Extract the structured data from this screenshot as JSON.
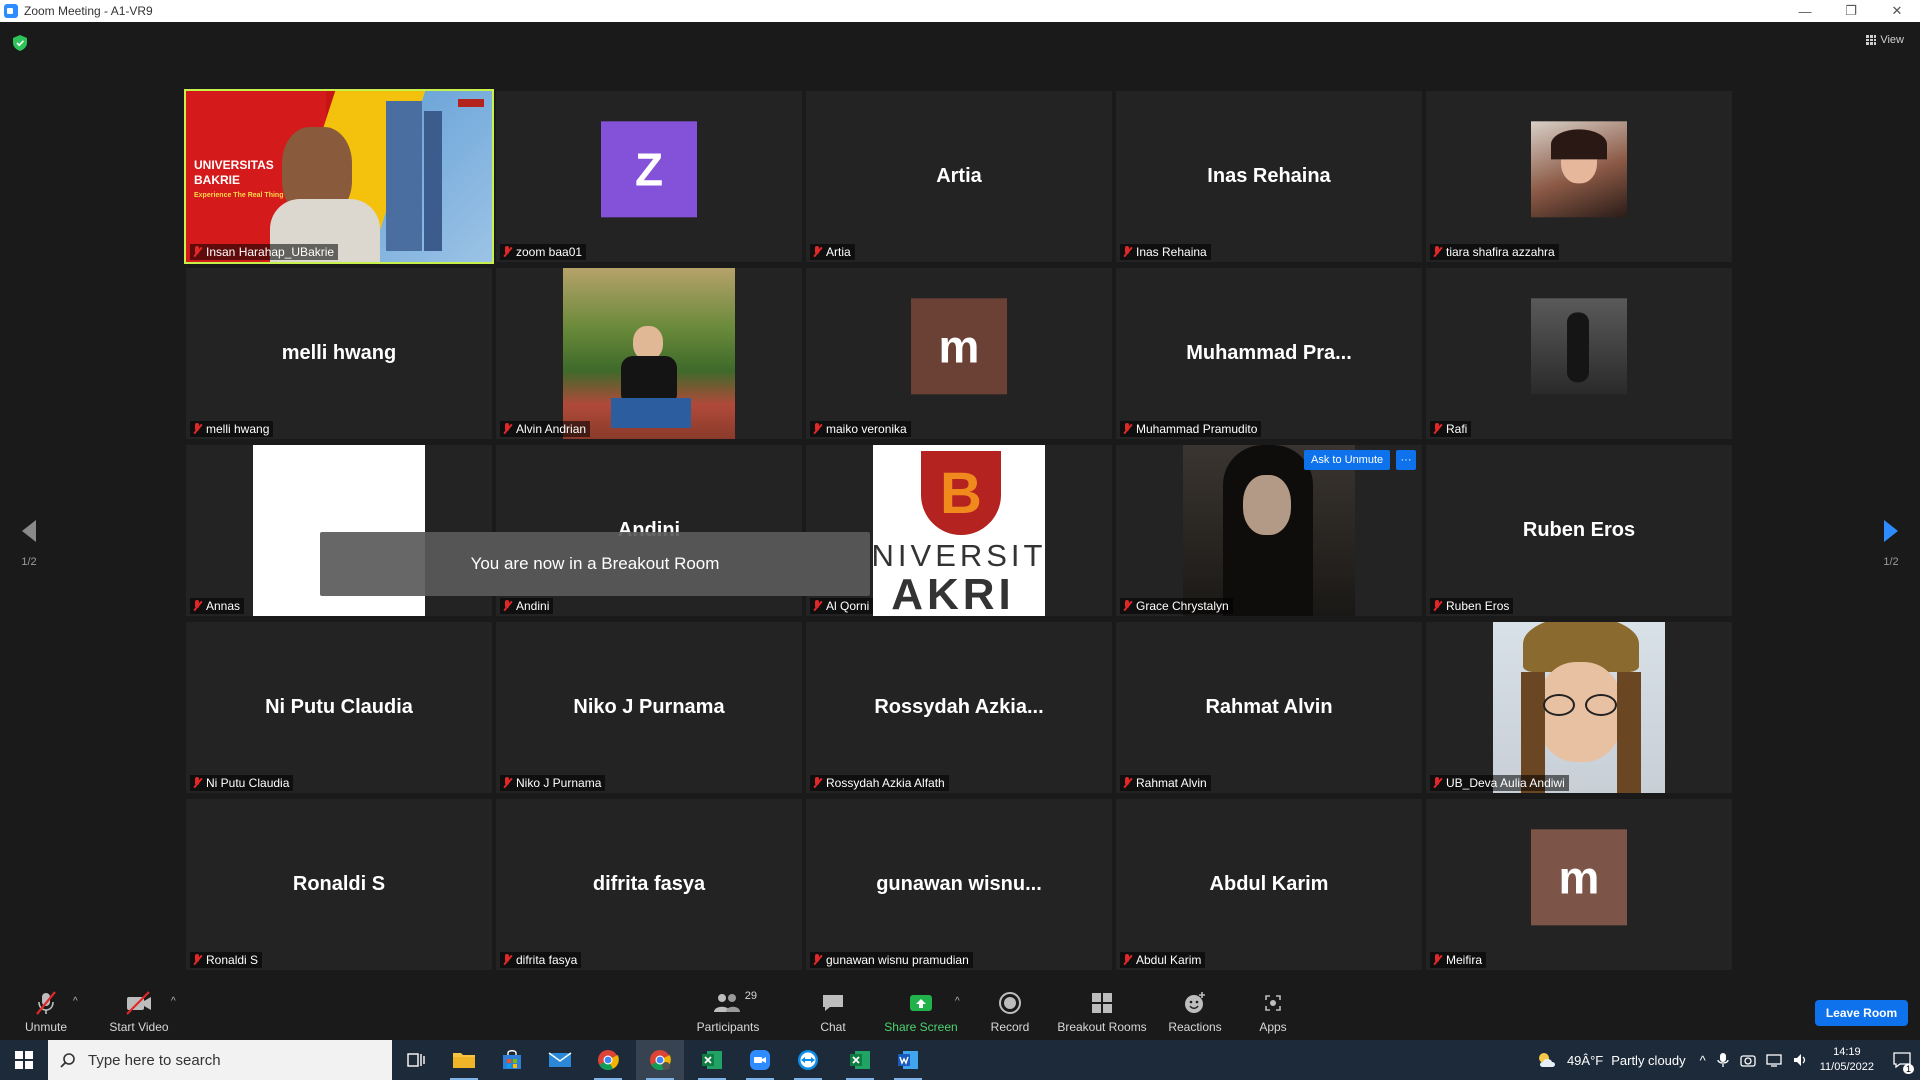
{
  "window": {
    "title": "Zoom Meeting - A1-VR9"
  },
  "header": {
    "view_label": "View"
  },
  "tiles": [
    {
      "name": "Insan Harahap_UBakrie",
      "big": "",
      "kind": "video-ub"
    },
    {
      "name": "zoom baa01",
      "big": "Z",
      "kind": "letter",
      "color": "#8452d9"
    },
    {
      "name": "Artia",
      "big": "Artia",
      "kind": "name"
    },
    {
      "name": "Inas Rehaina",
      "big": "Inas Rehaina",
      "kind": "name"
    },
    {
      "name": "tiara shafira azzahra",
      "big": "",
      "kind": "photo-sq",
      "color": "#5a3b30"
    },
    {
      "name": "melli hwang",
      "big": "melli hwang",
      "kind": "name"
    },
    {
      "name": "Alvin Andrian",
      "big": "",
      "kind": "photo-wide"
    },
    {
      "name": "maiko veronika",
      "big": "m",
      "kind": "letter",
      "color": "#6b4136"
    },
    {
      "name": "Muhammad Pramudito",
      "big": "Muhammad  Pra...",
      "kind": "name"
    },
    {
      "name": "Rafi",
      "big": "",
      "kind": "photo-sq-dark"
    },
    {
      "name": "Annas",
      "big": "",
      "kind": "white"
    },
    {
      "name": "Andini",
      "big": "Andini",
      "kind": "name"
    },
    {
      "name": "Al Qorni",
      "big": "",
      "kind": "ub-logo"
    },
    {
      "name": "Grace Chrystalyn",
      "big": "",
      "kind": "video-dark"
    },
    {
      "name": "Ruben Eros",
      "big": "Ruben Eros",
      "kind": "name"
    },
    {
      "name": "Ni Putu Claudia",
      "big": "Ni Putu Claudia",
      "kind": "name"
    },
    {
      "name": "Niko J Purnama",
      "big": "Niko J Purnama",
      "kind": "name"
    },
    {
      "name": "Rossydah Azkia Alfath",
      "big": "Rossydah  Azkia...",
      "kind": "name"
    },
    {
      "name": "Rahmat Alvin",
      "big": "Rahmat Alvin",
      "kind": "name"
    },
    {
      "name": "UB_Deva Aulia Andiwi",
      "big": "",
      "kind": "photo-hat"
    },
    {
      "name": "Ronaldi S",
      "big": "Ronaldi S",
      "kind": "name"
    },
    {
      "name": "difrita fasya",
      "big": "difrita fasya",
      "kind": "name"
    },
    {
      "name": "gunawan wisnu pramudian",
      "big": "gunawan  wisnu...",
      "kind": "name"
    },
    {
      "name": "Abdul Karim",
      "big": "Abdul Karim",
      "kind": "name"
    },
    {
      "name": "Meifira",
      "big": "m",
      "kind": "letter",
      "color": "#7d5548"
    }
  ],
  "video_tile": {
    "line1": "UNIVERSITAS",
    "line2": "BAKRIE",
    "tagline": "Experience The Real Thing"
  },
  "ub_logo": {
    "letter": "B",
    "line1": "NIVERSIT",
    "line2": "AKRI"
  },
  "toast": "You are now in a Breakout Room",
  "ask_unmute": "Ask to Unmute",
  "more_label": "···",
  "pagination": {
    "left": "1/2",
    "right": "1/2"
  },
  "toolbar": {
    "unmute": "Unmute",
    "start_video": "Start Video",
    "participants": "Participants",
    "participant_count": "29",
    "chat": "Chat",
    "share_screen": "Share Screen",
    "record": "Record",
    "breakout_rooms": "Breakout Rooms",
    "reactions": "Reactions",
    "apps": "Apps",
    "leave_room": "Leave Room"
  },
  "taskbar": {
    "search_placeholder": "Type here to search",
    "weather": "49Â°F",
    "weather_desc": "Partly cloudy",
    "time": "14:19",
    "date": "11/05/2022",
    "notifications": "1"
  },
  "colors": {
    "accent": "#0e72ed",
    "speaker": "#c8f04a",
    "muted": "#e02828",
    "share": "#22b24c"
  }
}
